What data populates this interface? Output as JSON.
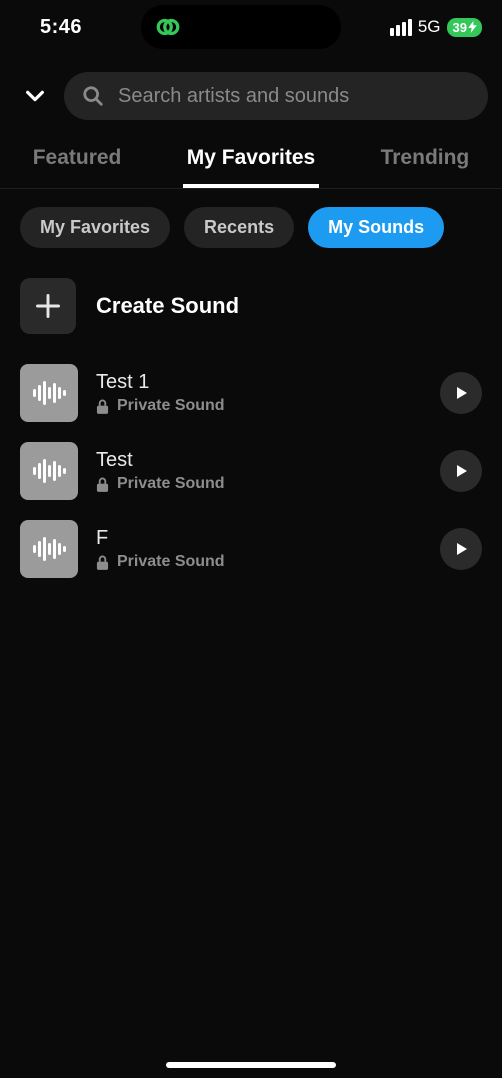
{
  "status": {
    "time": "5:46",
    "network": "5G",
    "battery": "39"
  },
  "search": {
    "placeholder": "Search artists and sounds"
  },
  "tabs": [
    {
      "label": "Featured",
      "active": false
    },
    {
      "label": "My Favorites",
      "active": true
    },
    {
      "label": "Trending",
      "active": false
    }
  ],
  "chips": [
    {
      "label": "My Favorites",
      "active": false
    },
    {
      "label": "Recents",
      "active": false
    },
    {
      "label": "My Sounds",
      "active": true
    }
  ],
  "create": {
    "label": "Create Sound"
  },
  "privacy_label": "Private Sound",
  "sounds": [
    {
      "title": "Test 1",
      "privacy": "Private Sound"
    },
    {
      "title": "Test",
      "privacy": "Private Sound"
    },
    {
      "title": "F",
      "privacy": "Private Sound"
    }
  ]
}
